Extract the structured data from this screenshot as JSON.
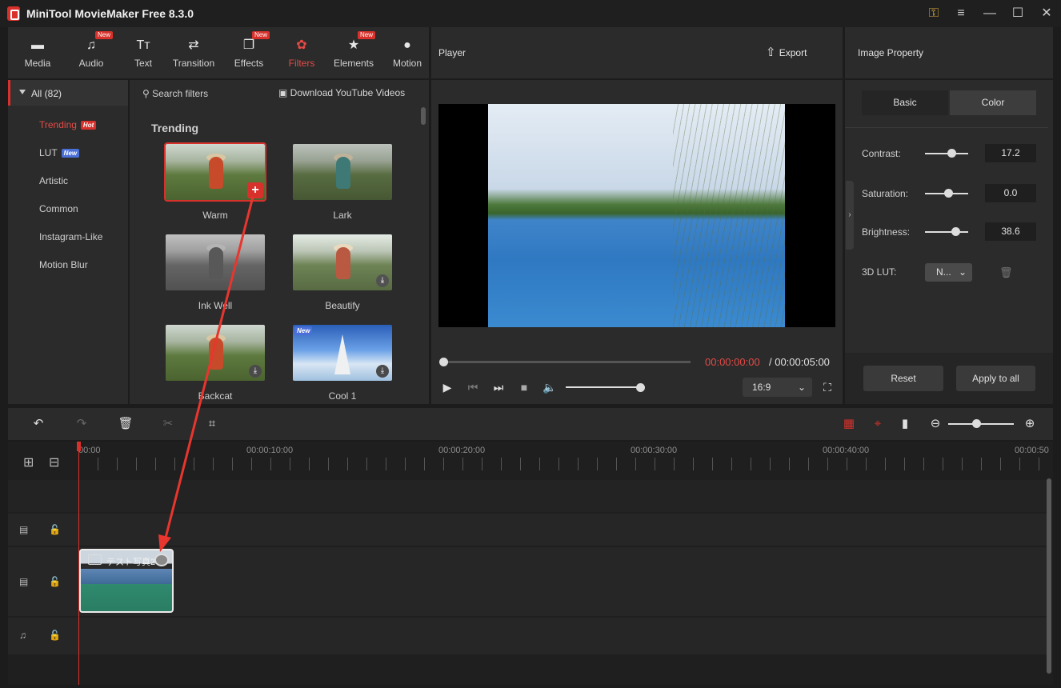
{
  "app": {
    "title": "MiniTool MovieMaker Free 8.3.0"
  },
  "toolbar": {
    "items": [
      {
        "label": "Media",
        "icon": "media-icon"
      },
      {
        "label": "Audio",
        "icon": "music-note-icon",
        "badge": "New"
      },
      {
        "label": "Text",
        "icon": "text-icon"
      },
      {
        "label": "Transition",
        "icon": "transition-icon"
      },
      {
        "label": "Effects",
        "icon": "effects-icon",
        "badge": "New"
      },
      {
        "label": "Filters",
        "icon": "filters-icon",
        "active": true
      },
      {
        "label": "Elements",
        "icon": "elements-icon",
        "badge": "New"
      },
      {
        "label": "Motion",
        "icon": "motion-icon"
      }
    ]
  },
  "categories": {
    "all_label": "All (82)",
    "items": [
      {
        "label": "Trending",
        "badge": "Hot",
        "active": true
      },
      {
        "label": "LUT",
        "badge": "New"
      },
      {
        "label": "Artistic"
      },
      {
        "label": "Common"
      },
      {
        "label": "Instagram-Like"
      },
      {
        "label": "Motion Blur"
      }
    ]
  },
  "filters": {
    "search_placeholder": "Search filters",
    "download_label": "Download YouTube Videos",
    "section_title": "Trending",
    "items": [
      {
        "label": "Warm",
        "state": "add"
      },
      {
        "label": "Lark",
        "state": "none"
      },
      {
        "label": "Ink Well",
        "state": "none"
      },
      {
        "label": "Beautify",
        "state": "download"
      },
      {
        "label": "Backcat",
        "state": "download"
      },
      {
        "label": "Cool 1",
        "state": "download",
        "badge": "New"
      }
    ]
  },
  "player": {
    "title": "Player",
    "export_label": "Export",
    "time_current": "00:00:00:00",
    "time_total": "/ 00:00:05:00",
    "aspect_ratio": "16:9"
  },
  "properties": {
    "title": "Image Property",
    "tabs": [
      "Basic",
      "Color"
    ],
    "active_tab": "Color",
    "rows": [
      {
        "label": "Contrast:",
        "value": "17.2"
      },
      {
        "label": "Saturation:",
        "value": "0.0"
      },
      {
        "label": "Brightness:",
        "value": "38.6"
      }
    ],
    "lut_label": "3D LUT:",
    "lut_value": "N...",
    "reset_label": "Reset",
    "apply_all_label": "Apply to all"
  },
  "timeline": {
    "ticks": [
      "00:00",
      "00:00:10:00",
      "00:00:20:00",
      "00:00:30:00",
      "00:00:40:00",
      "00:00:50"
    ],
    "clip_label": "テスト写真2"
  },
  "colors": {
    "accent": "#d8312b",
    "panel": "#2b2b2b",
    "background": "#1c1c1c"
  }
}
